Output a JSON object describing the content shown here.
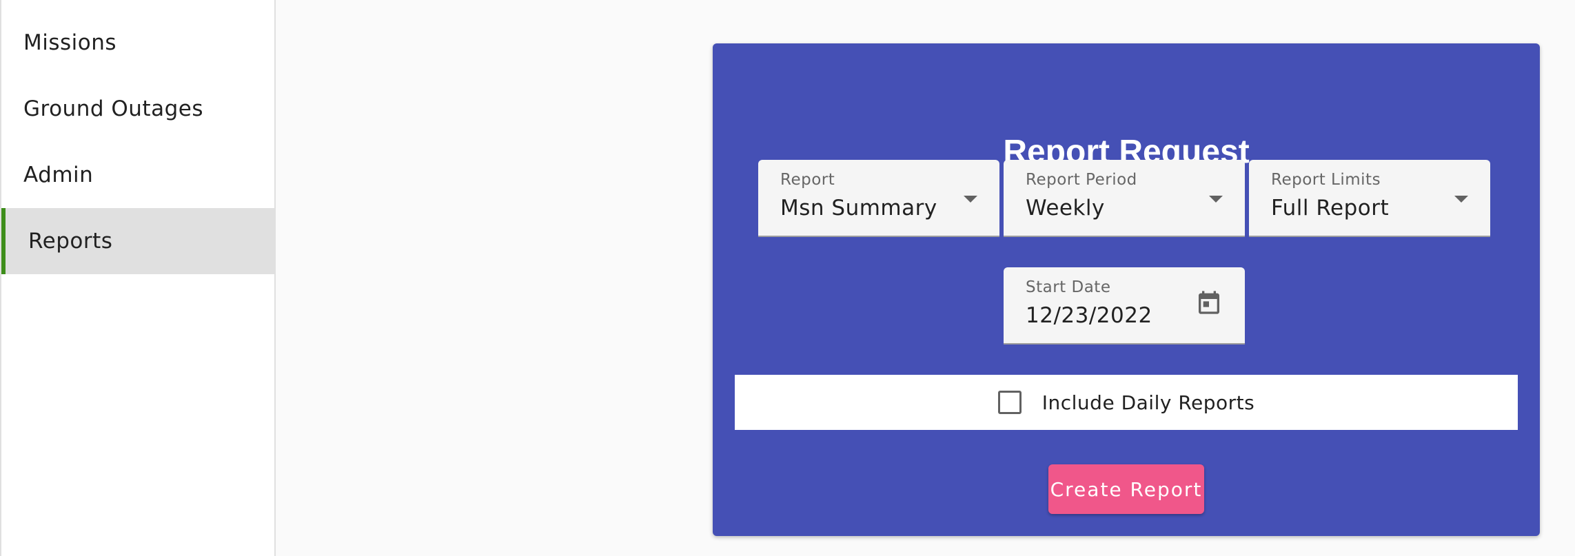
{
  "sidebar": {
    "items": [
      {
        "label": "Missions"
      },
      {
        "label": "Ground Outages"
      },
      {
        "label": "Admin"
      },
      {
        "label": "Reports"
      }
    ],
    "active_color": "#3e8e1b"
  },
  "card": {
    "title": "Report Request",
    "background": "#4550b5",
    "report": {
      "label": "Report",
      "value": "Msn Summary"
    },
    "period": {
      "label": "Report Period",
      "value": "Weekly"
    },
    "limits": {
      "label": "Report Limits",
      "value": "Full Report"
    },
    "start_date": {
      "label": "Start Date",
      "value": "12/23/2022",
      "icon": "calendar-icon"
    },
    "include_daily": {
      "label": "Include Daily Reports",
      "checked": false
    },
    "create_button": {
      "label": "Create Report",
      "color": "#f0578a"
    }
  }
}
